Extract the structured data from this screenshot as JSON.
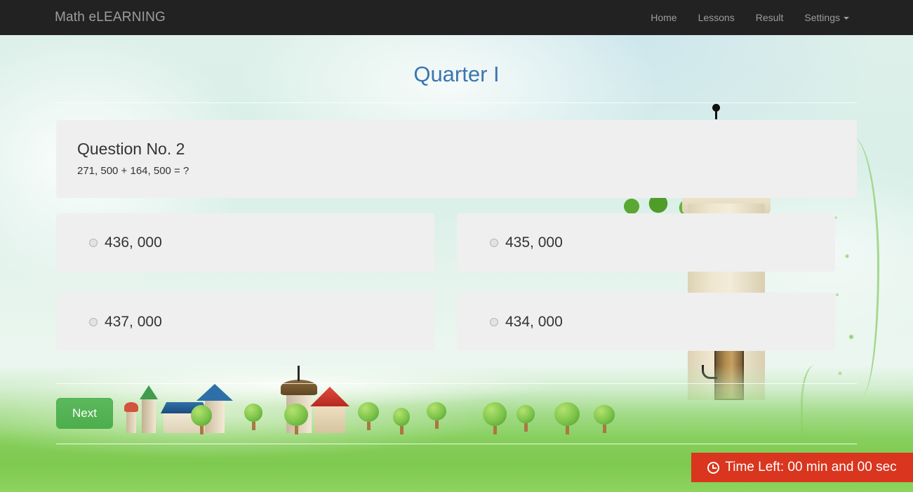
{
  "navbar": {
    "brand": "Math eLEARNING",
    "links": [
      {
        "label": "Home"
      },
      {
        "label": "Lessons"
      },
      {
        "label": "Result"
      },
      {
        "label": "Settings",
        "has_caret": true
      }
    ]
  },
  "main": {
    "page_title": "Quarter I",
    "question": {
      "heading": "Question No. 2",
      "text": "271, 500 + 164, 500 = ?"
    },
    "options": [
      {
        "label": "436, 000",
        "selected": false
      },
      {
        "label": "435, 000",
        "selected": false
      },
      {
        "label": "437, 000",
        "selected": false
      },
      {
        "label": "434, 000",
        "selected": false
      }
    ],
    "next_button": "Next"
  },
  "timer": {
    "text": "Time Left: 00 min and 00 sec",
    "icon": "clock-icon",
    "color": "#d9351f"
  },
  "colors": {
    "navbar_bg": "#222222",
    "navbar_text": "#9d9d9d",
    "title": "#3b76b0",
    "panel_bg": "#efefef",
    "next_button": "#5cb85c",
    "timer_bg": "#d9351f"
  }
}
